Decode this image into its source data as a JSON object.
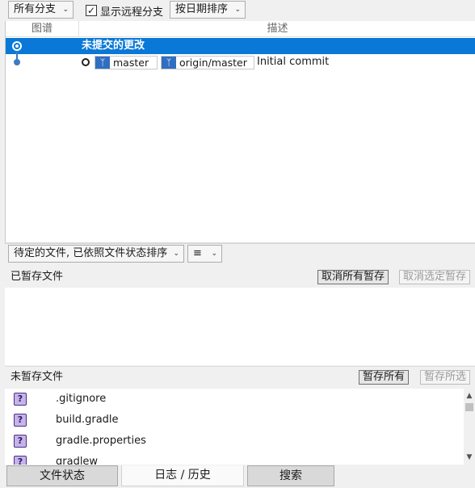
{
  "toolbar": {
    "branch_filter": "所有分支",
    "show_remote_label": "显示远程分支",
    "show_remote_checked": true,
    "sort_order": "按日期排序"
  },
  "graph": {
    "columns": {
      "graph": "图谱",
      "description": "描述"
    },
    "uncommitted_label": "未提交的更改",
    "commit": {
      "branches": [
        "master",
        "origin/master"
      ],
      "message": "Initial commit"
    }
  },
  "files_toolbar": {
    "sort_mode": "待定的文件, 已依照文件状态排序",
    "view_icon": "list-icon"
  },
  "staged": {
    "title": "已暂存文件",
    "unstage_all": "取消所有暂存",
    "unstage_selected": "取消选定暂存"
  },
  "unstaged": {
    "title": "未暂存文件",
    "stage_all": "暂存所有",
    "stage_selected": "暂存所选",
    "files": [
      ".gitignore",
      "build.gradle",
      "gradle.properties",
      "gradlew"
    ]
  },
  "tabs": [
    "文件状态",
    "日志 / 历史",
    "搜索"
  ],
  "colors": {
    "selection": "#0a78d7",
    "branch_icon": "#2f6ec2",
    "unknown_file_icon": "#c6b3ea"
  }
}
